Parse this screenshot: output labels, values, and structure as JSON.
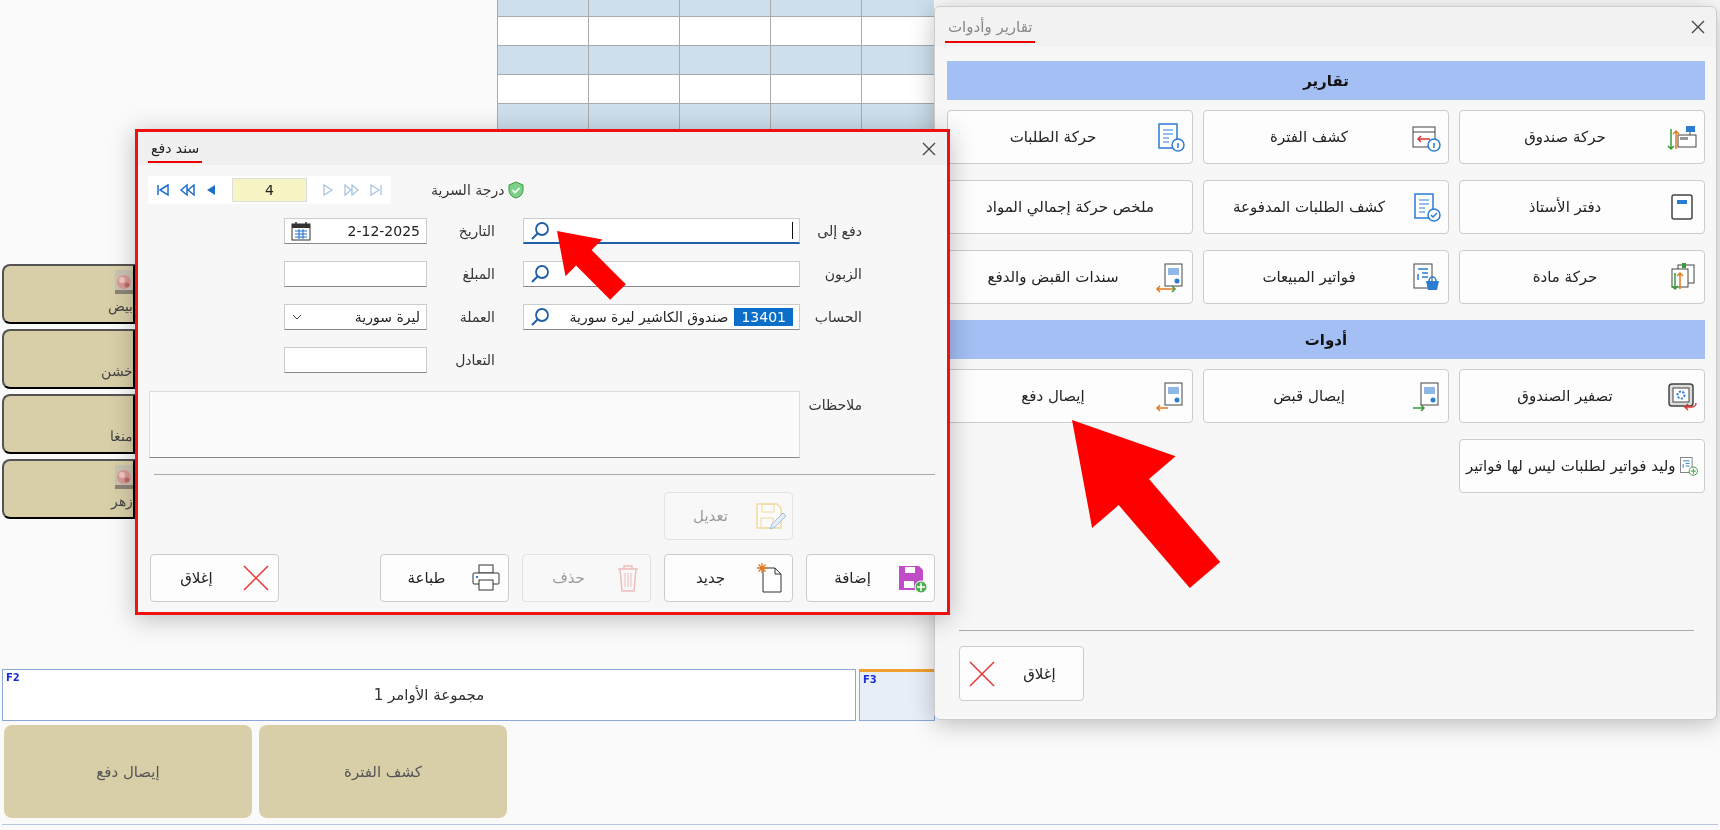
{
  "main_window": {
    "products": [
      {
        "label": "بيض",
        "picture": true
      },
      {
        "label": "خشن",
        "picture": false
      },
      {
        "label": "منغا",
        "picture": false
      },
      {
        "label": "زهر",
        "picture": true
      }
    ],
    "command_tabs": [
      {
        "key": "F3",
        "selected": true
      },
      {
        "key": "F2",
        "title": "مجموعة الأوامر 1",
        "selected": false
      }
    ],
    "commands": [
      "كشف الفترة",
      "إيصال دفع"
    ]
  },
  "payment_dialog": {
    "title": "سند دفع",
    "active": true,
    "navigator": {
      "record": "4",
      "buttons": [
        {
          "kind": "first",
          "disabled": false
        },
        {
          "kind": "rewind",
          "disabled": false
        },
        {
          "kind": "previous",
          "disabled": false
        },
        {
          "kind": "next",
          "disabled": true
        },
        {
          "kind": "forward",
          "disabled": true
        },
        {
          "kind": "last",
          "disabled": true
        }
      ]
    },
    "confidentiality": {
      "label": "درجة السرية"
    },
    "fields": [
      {
        "label": "دفع إلى",
        "kind": "search",
        "focused": true
      },
      {
        "label": "التاريخ",
        "kind": "date",
        "value": "2-12-2025",
        "focused": false
      },
      {
        "label": "الزبون",
        "kind": "search",
        "focused": false
      },
      {
        "label": "المبلغ",
        "kind": "text",
        "focused": false
      },
      {
        "label": "الحساب",
        "kind": "search",
        "code": "13401",
        "value": "صندوق الكاشير ليرة سورية",
        "focused": false
      },
      {
        "label": "العملة",
        "kind": "dropdown",
        "value": "ليرة سورية",
        "focused": false
      },
      {
        "label": "التعادل",
        "kind": "text",
        "focused": false
      }
    ],
    "notes": {
      "label": "ملاحظات"
    },
    "edit_button": {
      "label": "تعديل",
      "kind": "edit",
      "disabled": true
    },
    "buttons": [
      {
        "label": "إضافة",
        "kind": "save_add",
        "disabled": false
      },
      {
        "label": "جديد",
        "kind": "new",
        "disabled": false
      },
      {
        "label": "حذف",
        "kind": "delete",
        "disabled": true
      },
      {
        "label": "طباعة",
        "kind": "print",
        "disabled": false
      },
      {
        "label": "إغلاق",
        "kind": "close",
        "disabled": false
      }
    ]
  },
  "reports_panel": {
    "title": "تقارير وأدوات",
    "active": false,
    "sections": [
      {
        "title": "تقارير",
        "items": [
          {
            "label": "حركة صندوق",
            "kind": "cash_register"
          },
          {
            "label": "كشف الفترة",
            "kind": "calendar_info"
          },
          {
            "label": "حركة الطلبات",
            "kind": "list_info"
          },
          {
            "label": "دفتر الأستاذ",
            "kind": "ledger"
          },
          {
            "label": "كشف الطلبات المدفوعة",
            "kind": "list_check"
          },
          {
            "label": "ملخص حركة إجمالي المواد",
            "kind": "plain"
          },
          {
            "label": "حركة مادة",
            "kind": "item_move"
          },
          {
            "label": "فواتير المبيعات",
            "kind": "invoice_basket"
          },
          {
            "label": "سندات القبض والدفع",
            "kind": "voucher_both"
          }
        ]
      },
      {
        "title": "أدوات",
        "items": [
          {
            "label": "تصفير الصندوق",
            "kind": "safe"
          },
          {
            "label": "إيصال قبض",
            "kind": "voucher_in"
          },
          {
            "label": "إيصال دفع",
            "kind": "voucher_out"
          },
          {
            "label": "وليد فواتير لطلبات ليس لها فواتير",
            "kind": "invoice_add"
          }
        ]
      }
    ],
    "close_button": {
      "label": "إغلاق",
      "kind": "close"
    }
  }
}
